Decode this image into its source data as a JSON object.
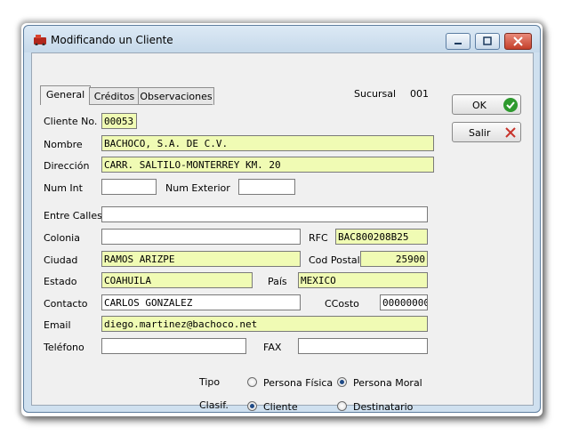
{
  "window": {
    "title": "Modificando un Cliente",
    "controls": [
      "minimize",
      "maximize",
      "close"
    ]
  },
  "tabs": [
    {
      "label": "General",
      "active": true
    },
    {
      "label": "Créditos",
      "active": false
    },
    {
      "label": "Observaciones",
      "active": false
    }
  ],
  "sucursal": {
    "label": "Sucursal",
    "value": "001"
  },
  "buttons": {
    "ok_label": "OK",
    "salir_label": "Salir"
  },
  "fields": {
    "cliente_no": {
      "label": "Cliente No.",
      "value": "00053"
    },
    "nombre": {
      "label": "Nombre",
      "value": "BACHOCO, S.A. DE C.V."
    },
    "direccion": {
      "label": "Dirección",
      "value": "CARR. SALTILO-MONTERREY KM. 20"
    },
    "num_int": {
      "label": "Num Int",
      "value": ""
    },
    "num_exterior": {
      "label": "Num Exterior",
      "value": ""
    },
    "entre_calles": {
      "label": "Entre Calles",
      "value": ""
    },
    "colonia": {
      "label": "Colonia",
      "value": ""
    },
    "rfc": {
      "label": "RFC",
      "value": "BAC800208B25"
    },
    "ciudad": {
      "label": "Ciudad",
      "value": "RAMOS ARIZPE"
    },
    "cod_postal": {
      "label": "Cod Postal",
      "value": "25900"
    },
    "estado": {
      "label": "Estado",
      "value": "COAHUILA"
    },
    "pais": {
      "label": "País",
      "value": "MEXICO"
    },
    "contacto": {
      "label": "Contacto",
      "value": "CARLOS GONZALEZ"
    },
    "ccosto": {
      "label": "CCosto",
      "value": "00000000"
    },
    "email": {
      "label": "Email",
      "value": "diego.martinez@bachoco.net"
    },
    "telefono": {
      "label": "Teléfono",
      "value": ""
    },
    "fax": {
      "label": "FAX",
      "value": ""
    }
  },
  "tipo": {
    "label": "Tipo",
    "options": [
      {
        "label": "Persona Física",
        "selected": false
      },
      {
        "label": "Persona Moral",
        "selected": true
      }
    ]
  },
  "clasif": {
    "label": "Clasif.",
    "options": [
      {
        "label": "Cliente",
        "selected": true
      },
      {
        "label": "Destinatario",
        "selected": false
      }
    ]
  },
  "colors": {
    "highlight_field": "#f0fbb4",
    "ok_icon": "#2e9a2e",
    "salir_icon": "#c8332b",
    "titlebar": "#c6d9ea"
  }
}
